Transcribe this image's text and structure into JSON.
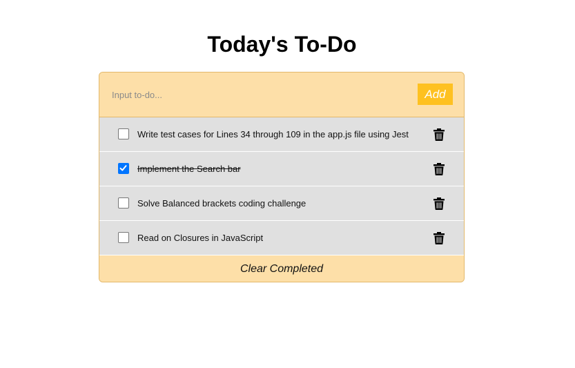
{
  "page": {
    "title": "Today's To-Do"
  },
  "input": {
    "placeholder": "Input to-do...",
    "value": "",
    "add_label": "Add"
  },
  "todos": [
    {
      "text": "Write test cases for Lines 34 through 109 in the app.js file using Jest",
      "completed": false,
      "delete_icon": "trash-icon"
    },
    {
      "text": "Implement the Search bar",
      "completed": true,
      "delete_icon": "trash-icon"
    },
    {
      "text": "Solve Balanced brackets coding challenge",
      "completed": false,
      "delete_icon": "trash-icon"
    },
    {
      "text": "Read on Closures in JavaScript",
      "completed": false,
      "delete_icon": "trash-icon"
    }
  ],
  "footer": {
    "clear_label": "Clear Completed"
  },
  "colors": {
    "panel": "#fddfa8",
    "add_button": "#fec121",
    "item_bg": "#e0e0e0",
    "checkbox_checked": "#0075ff"
  }
}
